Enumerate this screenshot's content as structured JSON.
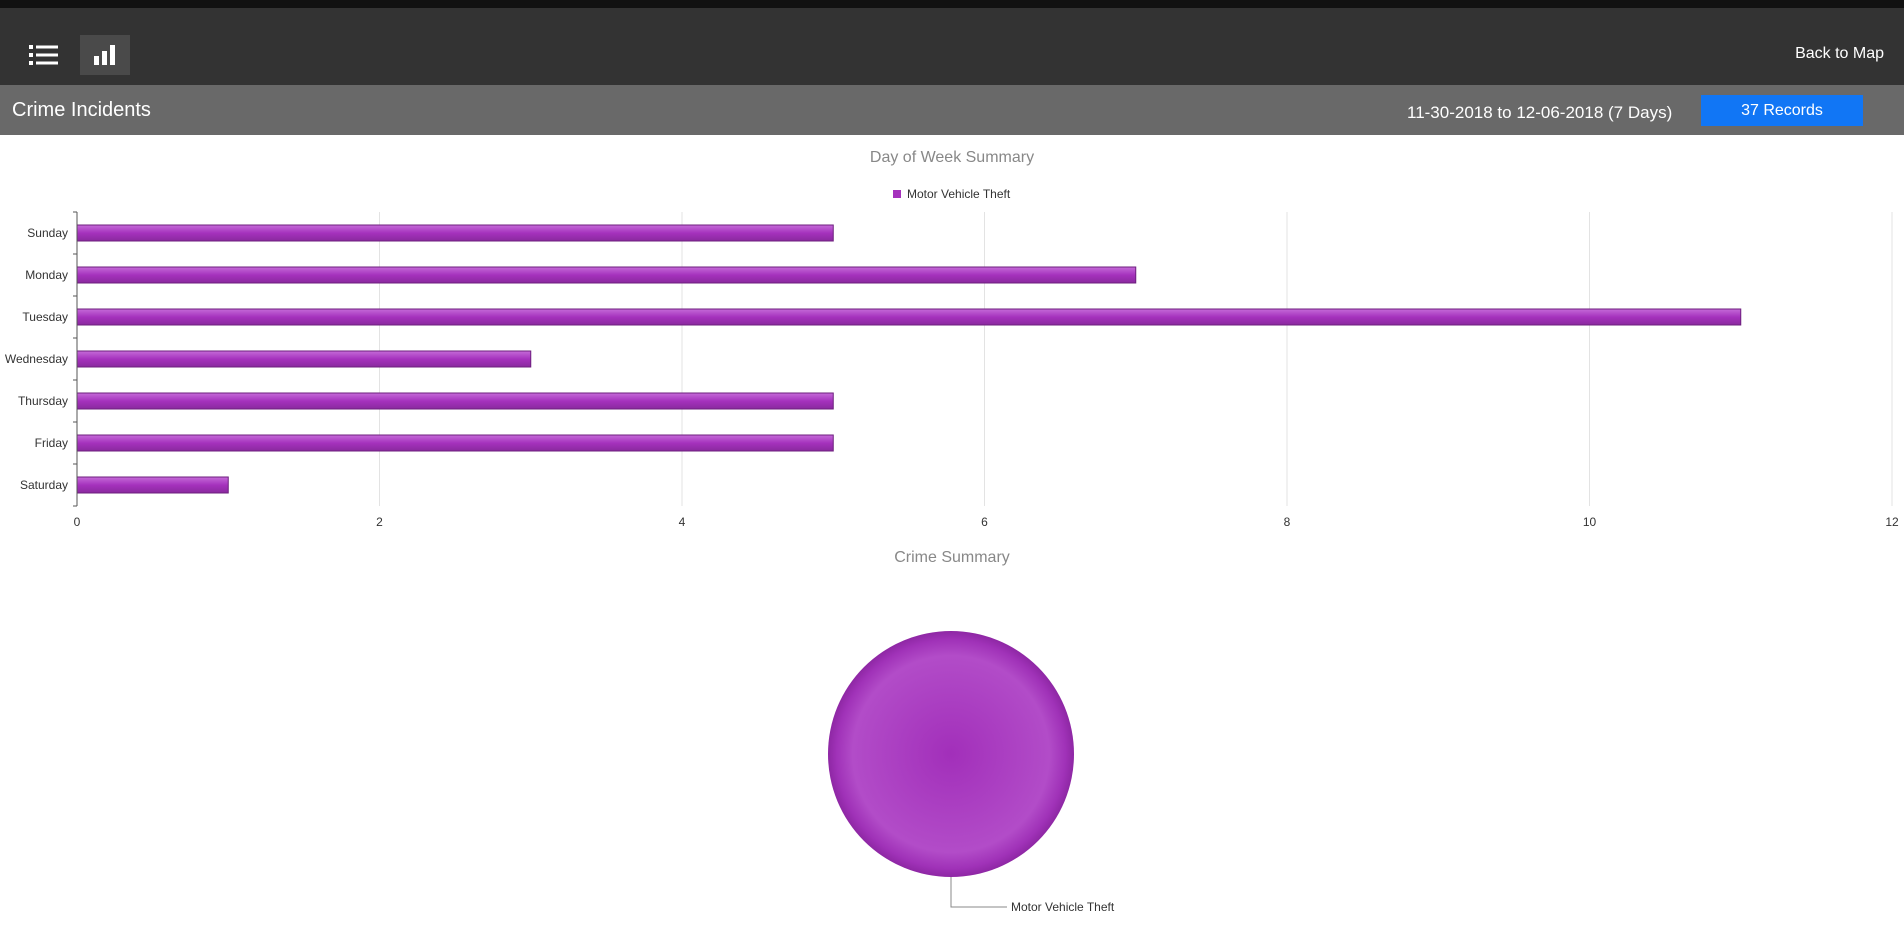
{
  "header": {
    "list_view_icon": "list-icon",
    "chart_view_icon": "bar-chart-icon",
    "back_label": "Back to Map"
  },
  "subheader": {
    "title": "Crime Incidents",
    "date_range": "11-30-2018 to 12-06-2018 (7 Days)",
    "records_label": "37 Records"
  },
  "colors": {
    "series": "#a532bd",
    "series_dark": "#6d1f7e",
    "navbar": "#333333",
    "subbar": "#696969",
    "records_button": "#1176f5"
  },
  "chart_data": [
    {
      "type": "bar",
      "orientation": "horizontal",
      "title": "Day of Week Summary",
      "categories": [
        "Sunday",
        "Monday",
        "Tuesday",
        "Wednesday",
        "Thursday",
        "Friday",
        "Saturday"
      ],
      "series": [
        {
          "name": "Motor Vehicle Theft",
          "values": [
            5,
            7,
            11,
            3,
            5,
            5,
            1
          ]
        }
      ],
      "xlim": [
        0,
        12
      ],
      "xticks": [
        0,
        2,
        4,
        6,
        8,
        10,
        12
      ],
      "grid": true,
      "legend": "top-center"
    },
    {
      "type": "pie",
      "title": "Crime Summary",
      "slices": [
        {
          "label": "Motor Vehicle Theft",
          "value": 37
        }
      ]
    }
  ]
}
